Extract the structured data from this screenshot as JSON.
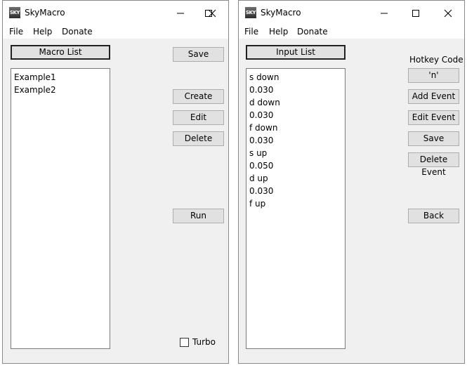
{
  "window_left": {
    "title": "SkyMacro",
    "icon_text": "SKY",
    "menu": [
      "File",
      "Help",
      "Donate"
    ],
    "header_button": "Macro List",
    "list_items": [
      "Example1",
      "Example2"
    ],
    "buttons": {
      "save": "Save",
      "create": "Create",
      "edit": "Edit",
      "delete": "Delete",
      "run": "Run"
    },
    "turbo_label": "Turbo",
    "turbo_checked": false
  },
  "window_right": {
    "title": "SkyMacro",
    "icon_text": "SKY",
    "menu": [
      "File",
      "Help",
      "Donate"
    ],
    "header_button": "Input List",
    "list_items": [
      "s down",
      "0.030",
      "d down",
      "0.030",
      "f down",
      "0.030",
      "s up",
      "0.050",
      "d up",
      "0.030",
      "f up"
    ],
    "hotkey_label": "Hotkey Code",
    "buttons": {
      "hotkey": "'n'",
      "add_event": "Add Event",
      "edit_event": "Edit Event",
      "save": "Save",
      "delete_event": "Delete Event",
      "back": "Back"
    }
  }
}
